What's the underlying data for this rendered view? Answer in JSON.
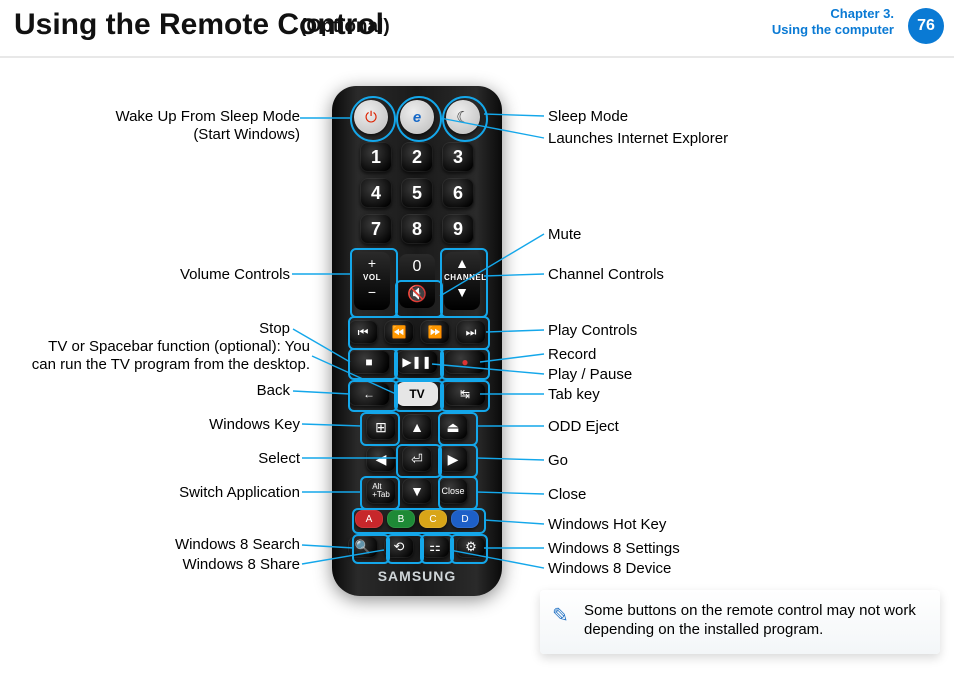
{
  "header": {
    "title": "Using the Remote Control",
    "subtitle": "(Optional)",
    "chapter_line1": "Chapter 3.",
    "chapter_line2": "Using the computer",
    "page_number": "76"
  },
  "remote": {
    "brand": "SAMSUNG",
    "buttons": {
      "power": "⏻",
      "ie": "e",
      "sleep": "☾",
      "num1": "1",
      "num2": "2",
      "num3": "3",
      "num4": "4",
      "num5": "5",
      "num6": "6",
      "num7": "7",
      "num8": "8",
      "num9": "9",
      "zero": "0",
      "vol_plus": "+",
      "vol_label": "VOL",
      "vol_minus": "−",
      "mute": "🔇",
      "ch_up": "▲",
      "ch_label": "CHANNEL",
      "ch_down": "▼",
      "prev": "⏮",
      "rew": "⏪",
      "ffwd": "⏩",
      "next": "⏭",
      "stop": "■",
      "playpause": "▶❚❚",
      "record": "●",
      "back": "←",
      "tv": "TV",
      "tab": "↹",
      "win": "⊞",
      "navup": "▲",
      "eject": "⏏",
      "navleft": "◀",
      "select": "⏎",
      "navright": "▶",
      "alttab": "Alt\n+Tab",
      "navdown": "▼",
      "close": "Close",
      "A": "A",
      "B": "B",
      "C": "C",
      "D": "D",
      "search": "🔍",
      "share": "⟲",
      "device": "⚏",
      "settings": "⚙"
    }
  },
  "labels": {
    "left": {
      "wake1": "Wake Up From Sleep Mode",
      "wake2": "(Start Windows)",
      "volume": "Volume Controls",
      "stop": "Stop",
      "tv1": "TV or Spacebar function (optional): You",
      "tv2": "can run the TV program from the desktop.",
      "back": "Back",
      "winkey": "Windows Key",
      "select": "Select",
      "switchapp": "Switch Application",
      "w8search": "Windows 8 Search",
      "w8share": "Windows 8 Share"
    },
    "right": {
      "sleep": "Sleep Mode",
      "ie": "Launches Internet Explorer",
      "mute": "Mute",
      "channel": "Channel Controls",
      "playctrl": "Play Controls",
      "record": "Record",
      "playpause": "Play / Pause",
      "tabkey": "Tab key",
      "oddeject": "ODD Eject",
      "go": "Go",
      "close": "Close",
      "hotkey": "Windows Hot Key",
      "w8settings": "Windows 8 Settings",
      "w8device": "Windows 8 Device"
    }
  },
  "note": "Some buttons on the remote control may not work depending on the installed program."
}
